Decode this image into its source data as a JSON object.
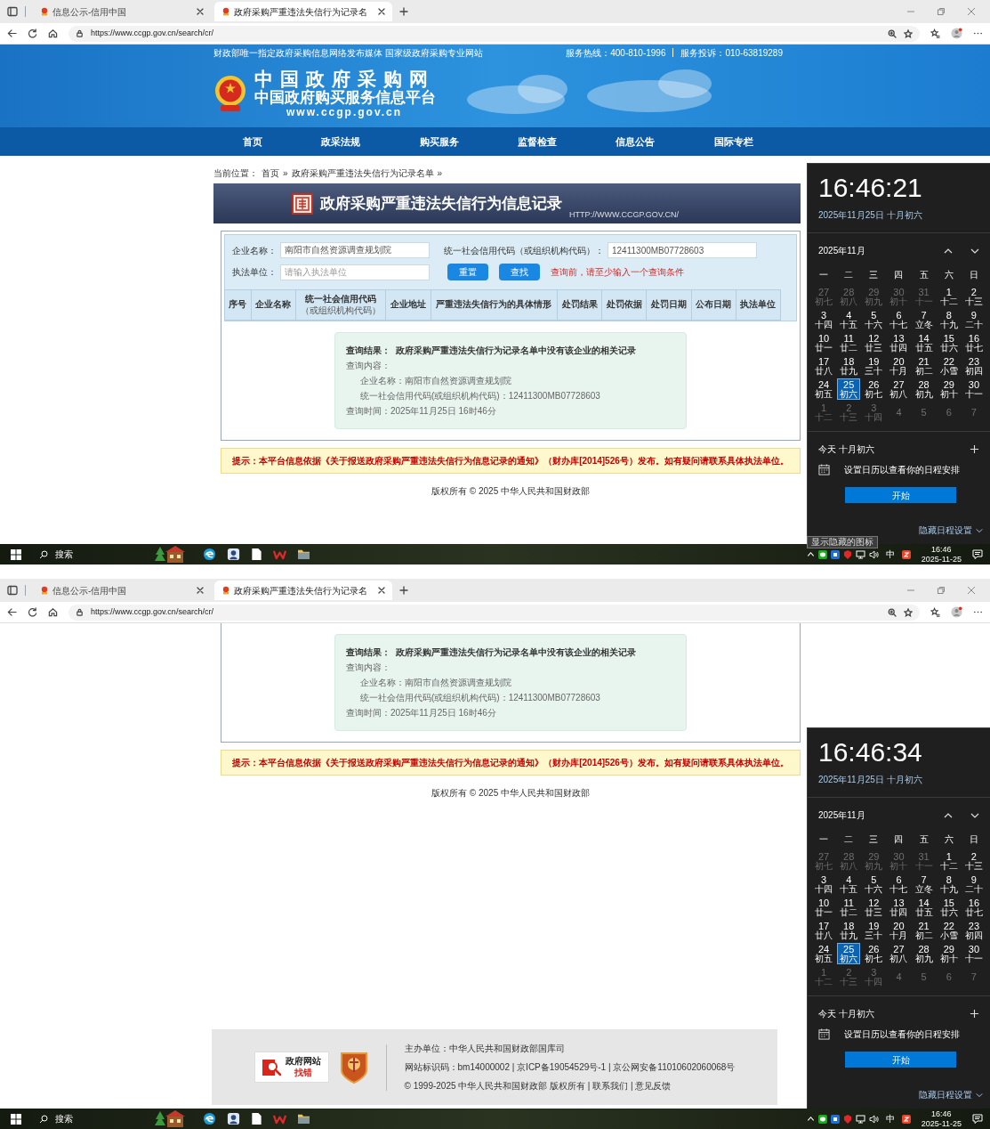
{
  "screens": [
    {
      "browser": {
        "tabs": [
          {
            "label": "信息公示-信用中国",
            "selected": false
          },
          {
            "label": "政府采购严重违法失信行为记录名",
            "selected": true
          }
        ],
        "url": "https://www.ccgp.gov.cn/search/cr/"
      },
      "site_header": {
        "tagline": "财政部唯一指定政府采购信息网络发布媒体 国家级政府采购专业网站",
        "hotline": "服务热线：400-810-1996",
        "complaint": "服务投诉：010-63819289",
        "logo_title": "中国政府采购网",
        "logo_subtitle": "中国政府购买服务信息平台",
        "logo_url": "www.ccgp.gov.cn"
      },
      "nav": [
        "首页",
        "政采法规",
        "购买服务",
        "监督检查",
        "信息公告",
        "国际专栏"
      ],
      "breadcrumb": {
        "label": "当前位置：",
        "links": [
          "首页",
          "政府采购严重违法失信行为记录名单"
        ],
        "separator": "»"
      },
      "banner": {
        "title": "政府采购严重违法失信行为信息记录",
        "url": "HTTP://WWW.CCGP.GOV.CN/"
      },
      "search_form": {
        "fields": [
          {
            "label": "企业名称：",
            "value": "南阳市自然资源调查规划院"
          },
          {
            "label": "统一社会信用代码（或组织机构代码）：",
            "value": "12411300MB07728603"
          },
          {
            "label": "执法单位：",
            "placeholder": "请输入执法单位"
          }
        ],
        "buttons": [
          "重置",
          "查找"
        ],
        "hint": "查询前，请至少输入一个查询条件"
      },
      "table_columns": [
        {
          "label": "序号"
        },
        {
          "label": "企业名称"
        },
        {
          "label": "统一社会信用代码",
          "sublabel": "（或组织机构代码）"
        },
        {
          "label": "企业地址"
        },
        {
          "label": "严重违法失信行为的具体情形"
        },
        {
          "label": "处罚结果"
        },
        {
          "label": "处罚依据"
        },
        {
          "label": "处罚日期"
        },
        {
          "label": "公布日期"
        },
        {
          "label": "执法单位"
        }
      ],
      "result": [
        {
          "kind": "heading",
          "text": "查询结果：  政府采购严重违法失信行为记录名单中没有该企业的相关记录"
        },
        {
          "kind": "plain",
          "text": "查询内容："
        },
        {
          "kind": "indent",
          "text": "企业名称：南阳市自然资源调查规划院"
        },
        {
          "kind": "indent",
          "text": "统一社会信用代码(或组织机构代码)：12411300MB07728603"
        },
        {
          "kind": "plain",
          "text": "查询时间：2025年11月25日 16时46分"
        }
      ],
      "notice": "提示：本平台信息依据《关于报送政府采购严重违法失信行为信息记录的通知》（财办库[2014]526号）发布。如有疑问请联系具体执法单位。",
      "copyright": "版权所有 © 2025 中华人民共和国财政部",
      "calendar": {
        "time": "16:46:21",
        "date": "2025年11月25日 十月初六",
        "month": "2025年11月",
        "weekdays": [
          "一",
          "二",
          "三",
          "四",
          "五",
          "六",
          "日"
        ],
        "days": [
          {
            "day": "27",
            "lunar": "初七",
            "current": false,
            "selected": false
          },
          {
            "day": "28",
            "lunar": "初八",
            "current": false,
            "selected": false
          },
          {
            "day": "29",
            "lunar": "初九",
            "current": false,
            "selected": false
          },
          {
            "day": "30",
            "lunar": "初十",
            "current": false,
            "selected": false
          },
          {
            "day": "31",
            "lunar": "十一",
            "current": false,
            "selected": false
          },
          {
            "day": "1",
            "lunar": "十二",
            "current": true,
            "selected": false
          },
          {
            "day": "2",
            "lunar": "十三",
            "current": true,
            "selected": false
          },
          {
            "day": "3",
            "lunar": "十四",
            "current": true,
            "selected": false
          },
          {
            "day": "4",
            "lunar": "十五",
            "current": true,
            "selected": false
          },
          {
            "day": "5",
            "lunar": "十六",
            "current": true,
            "selected": false
          },
          {
            "day": "6",
            "lunar": "十七",
            "current": true,
            "selected": false
          },
          {
            "day": "7",
            "lunar": "立冬",
            "current": true,
            "selected": false
          },
          {
            "day": "8",
            "lunar": "十九",
            "current": true,
            "selected": false
          },
          {
            "day": "9",
            "lunar": "二十",
            "current": true,
            "selected": false
          },
          {
            "day": "10",
            "lunar": "廿一",
            "current": true,
            "selected": false
          },
          {
            "day": "11",
            "lunar": "廿二",
            "current": true,
            "selected": false
          },
          {
            "day": "12",
            "lunar": "廿三",
            "current": true,
            "selected": false
          },
          {
            "day": "13",
            "lunar": "廿四",
            "current": true,
            "selected": false
          },
          {
            "day": "14",
            "lunar": "廿五",
            "current": true,
            "selected": false
          },
          {
            "day": "15",
            "lunar": "廿六",
            "current": true,
            "selected": false
          },
          {
            "day": "16",
            "lunar": "廿七",
            "current": true,
            "selected": false
          },
          {
            "day": "17",
            "lunar": "廿八",
            "current": true,
            "selected": false
          },
          {
            "day": "18",
            "lunar": "廿九",
            "current": true,
            "selected": false
          },
          {
            "day": "19",
            "lunar": "三十",
            "current": true,
            "selected": false
          },
          {
            "day": "20",
            "lunar": "十月",
            "current": true,
            "selected": false
          },
          {
            "day": "21",
            "lunar": "初二",
            "current": true,
            "selected": false
          },
          {
            "day": "22",
            "lunar": "小雪",
            "current": true,
            "selected": false
          },
          {
            "day": "23",
            "lunar": "初四",
            "current": true,
            "selected": false
          },
          {
            "day": "24",
            "lunar": "初五",
            "current": true,
            "selected": false
          },
          {
            "day": "25",
            "lunar": "初六",
            "current": true,
            "selected": true
          },
          {
            "day": "26",
            "lunar": "初七",
            "current": true,
            "selected": false
          },
          {
            "day": "27",
            "lunar": "初八",
            "current": true,
            "selected": false
          },
          {
            "day": "28",
            "lunar": "初九",
            "current": true,
            "selected": false
          },
          {
            "day": "29",
            "lunar": "初十",
            "current": true,
            "selected": false
          },
          {
            "day": "30",
            "lunar": "十一",
            "current": true,
            "selected": false
          },
          {
            "day": "1",
            "lunar": "十二",
            "current": false,
            "selected": false
          },
          {
            "day": "2",
            "lunar": "十三",
            "current": false,
            "selected": false
          },
          {
            "day": "3",
            "lunar": "十四",
            "current": false,
            "selected": false
          },
          {
            "day": "4",
            "current": false,
            "selected": false
          },
          {
            "day": "5",
            "current": false,
            "selected": false
          },
          {
            "day": "6",
            "current": false,
            "selected": false
          },
          {
            "day": "7",
            "current": false,
            "selected": false
          }
        ],
        "today": "今天 十月初六",
        "agenda": "设置日历以查看你的日程安排",
        "start_button": "开始",
        "hide_agenda": "隐藏日程设置"
      },
      "tooltip": "显示隐藏的图标",
      "taskbar": {
        "search": "搜索",
        "ime": "中",
        "time": "16:46",
        "date": "2025-11-25"
      }
    },
    {
      "browser": {
        "tabs": [
          {
            "label": "信息公示-信用中国",
            "selected": false
          },
          {
            "label": "政府采购严重违法失信行为记录名",
            "selected": true
          }
        ],
        "url": "https://www.ccgp.gov.cn/search/cr/"
      },
      "result": [
        {
          "kind": "heading",
          "text": "查询结果：  政府采购严重违法失信行为记录名单中没有该企业的相关记录"
        },
        {
          "kind": "plain",
          "text": "查询内容："
        },
        {
          "kind": "indent",
          "text": "企业名称：南阳市自然资源调查规划院"
        },
        {
          "kind": "indent",
          "text": "统一社会信用代码(或组织机构代码)：12411300MB07728603"
        },
        {
          "kind": "plain",
          "text": "查询时间：2025年11月25日 16时46分"
        }
      ],
      "notice": "提示：本平台信息依据《关于报送政府采购严重违法失信行为信息记录的通知》（财办库[2014]526号）发布。如有疑问请联系具体执法单位。",
      "copyright": "版权所有 © 2025 中华人民共和国财政部",
      "footer": {
        "badge_title": "政府网站",
        "badge_subtitle": "找错",
        "lines": [
          "主办单位：中华人民共和国财政部国库司",
          "网站标识码：bm14000002 | 京ICP备19054529号-1 | 京公网安备11010602060068号",
          "© 1999-2025 中华人民共和国财政部 版权所有 | 联系我们 | 意见反馈"
        ]
      },
      "calendar": {
        "time": "16:46:34",
        "date": "2025年11月25日 十月初六",
        "month": "2025年11月",
        "weekdays": [
          "一",
          "二",
          "三",
          "四",
          "五",
          "六",
          "日"
        ],
        "days": [
          {
            "day": "27",
            "lunar": "初七",
            "current": false,
            "selected": false
          },
          {
            "day": "28",
            "lunar": "初八",
            "current": false,
            "selected": false
          },
          {
            "day": "29",
            "lunar": "初九",
            "current": false,
            "selected": false
          },
          {
            "day": "30",
            "lunar": "初十",
            "current": false,
            "selected": false
          },
          {
            "day": "31",
            "lunar": "十一",
            "current": false,
            "selected": false
          },
          {
            "day": "1",
            "lunar": "十二",
            "current": true,
            "selected": false
          },
          {
            "day": "2",
            "lunar": "十三",
            "current": true,
            "selected": false
          },
          {
            "day": "3",
            "lunar": "十四",
            "current": true,
            "selected": false
          },
          {
            "day": "4",
            "lunar": "十五",
            "current": true,
            "selected": false
          },
          {
            "day": "5",
            "lunar": "十六",
            "current": true,
            "selected": false
          },
          {
            "day": "6",
            "lunar": "十七",
            "current": true,
            "selected": false
          },
          {
            "day": "7",
            "lunar": "立冬",
            "current": true,
            "selected": false
          },
          {
            "day": "8",
            "lunar": "十九",
            "current": true,
            "selected": false
          },
          {
            "day": "9",
            "lunar": "二十",
            "current": true,
            "selected": false
          },
          {
            "day": "10",
            "lunar": "廿一",
            "current": true,
            "selected": false
          },
          {
            "day": "11",
            "lunar": "廿二",
            "current": true,
            "selected": false
          },
          {
            "day": "12",
            "lunar": "廿三",
            "current": true,
            "selected": false
          },
          {
            "day": "13",
            "lunar": "廿四",
            "current": true,
            "selected": false
          },
          {
            "day": "14",
            "lunar": "廿五",
            "current": true,
            "selected": false
          },
          {
            "day": "15",
            "lunar": "廿六",
            "current": true,
            "selected": false
          },
          {
            "day": "16",
            "lunar": "廿七",
            "current": true,
            "selected": false
          },
          {
            "day": "17",
            "lunar": "廿八",
            "current": true,
            "selected": false
          },
          {
            "day": "18",
            "lunar": "廿九",
            "current": true,
            "selected": false
          },
          {
            "day": "19",
            "lunar": "三十",
            "current": true,
            "selected": false
          },
          {
            "day": "20",
            "lunar": "十月",
            "current": true,
            "selected": false
          },
          {
            "day": "21",
            "lunar": "初二",
            "current": true,
            "selected": false
          },
          {
            "day": "22",
            "lunar": "小雪",
            "current": true,
            "selected": false
          },
          {
            "day": "23",
            "lunar": "初四",
            "current": true,
            "selected": false
          },
          {
            "day": "24",
            "lunar": "初五",
            "current": true,
            "selected": false
          },
          {
            "day": "25",
            "lunar": "初六",
            "current": true,
            "selected": true
          },
          {
            "day": "26",
            "lunar": "初七",
            "current": true,
            "selected": false
          },
          {
            "day": "27",
            "lunar": "初八",
            "current": true,
            "selected": false
          },
          {
            "day": "28",
            "lunar": "初九",
            "current": true,
            "selected": false
          },
          {
            "day": "29",
            "lunar": "初十",
            "current": true,
            "selected": false
          },
          {
            "day": "30",
            "lunar": "十一",
            "current": true,
            "selected": false
          },
          {
            "day": "1",
            "lunar": "十二",
            "current": false,
            "selected": false
          },
          {
            "day": "2",
            "lunar": "十三",
            "current": false,
            "selected": false
          },
          {
            "day": "3",
            "lunar": "十四",
            "current": false,
            "selected": false
          },
          {
            "day": "4",
            "current": false,
            "selected": false
          },
          {
            "day": "5",
            "current": false,
            "selected": false
          },
          {
            "day": "6",
            "current": false,
            "selected": false
          },
          {
            "day": "7",
            "current": false,
            "selected": false
          }
        ],
        "today": "今天 十月初六",
        "agenda": "设置日历以查看你的日程安排",
        "start_button": "开始",
        "hide_agenda": "隐藏日程设置"
      },
      "taskbar": {
        "search": "搜索",
        "ime": "中",
        "time": "16:46",
        "date": "2025-11-25"
      }
    }
  ]
}
